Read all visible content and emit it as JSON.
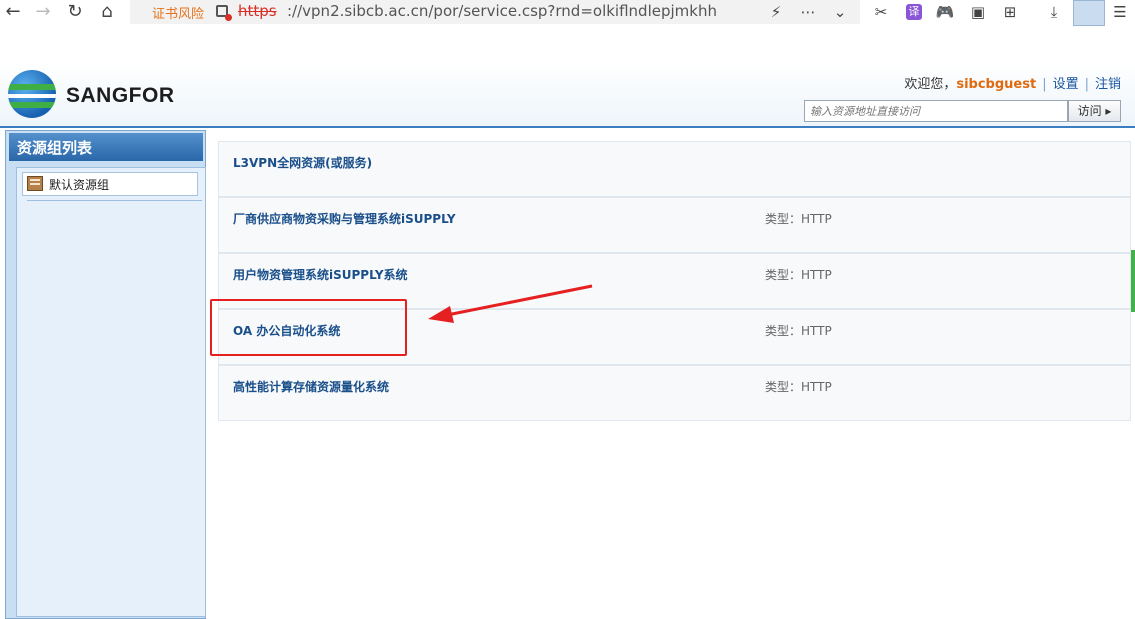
{
  "browser": {
    "cert_warning": "证书风险",
    "url_scheme": "https",
    "url_rest": "://vpn2.sibcb.ac.cn/por/service.csp?rnd=olkiflndlepjmkhh",
    "ext_translate_label": "译"
  },
  "header": {
    "logo_text": "SANGFOR",
    "welcome_prefix": "欢迎您，",
    "username": "sibcbguest",
    "settings_link": "设置",
    "logout_link": "注销",
    "separator": "|",
    "search_placeholder": "输入资源地址直接访问",
    "visit_button": "访问 ▸"
  },
  "sidebar": {
    "title": "资源组列表",
    "items": [
      {
        "label": "默认资源组"
      }
    ]
  },
  "resources": [
    {
      "name": "L3VPN全网资源(或服务)",
      "type": ""
    },
    {
      "name": "厂商供应商物资采购与管理系统iSUPPLY",
      "type": "类型：HTTP"
    },
    {
      "name": "用户物资管理系统iSUPPLY系统",
      "type": "类型：HTTP"
    },
    {
      "name": "OA 办公自动化系统",
      "type": "类型：HTTP"
    },
    {
      "name": "高性能计算存储资源量化系统",
      "type": "类型：HTTP"
    }
  ],
  "colors": {
    "annotation_red": "#e62020",
    "accent_blue": "#2a67a9",
    "username_orange": "#e06a10"
  }
}
